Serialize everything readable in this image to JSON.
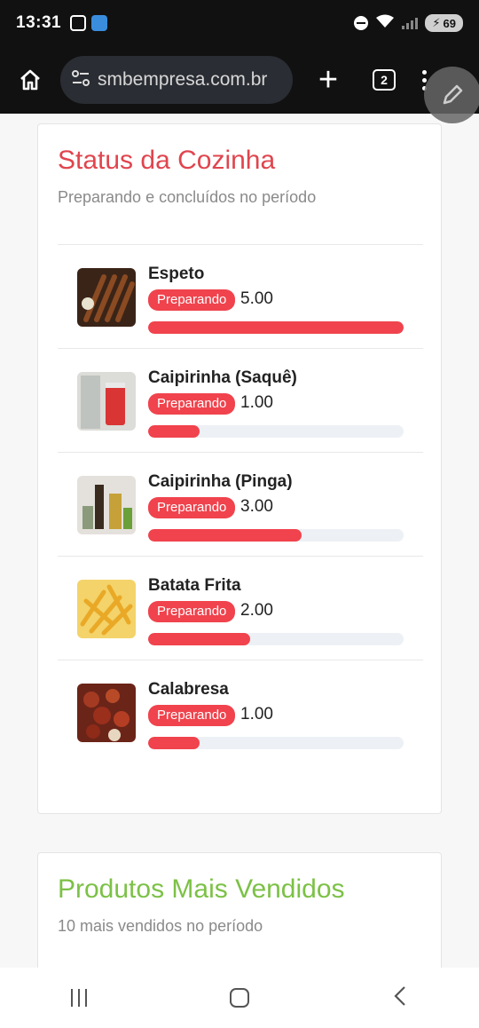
{
  "status_bar": {
    "time": "13:31",
    "battery": "69"
  },
  "browser": {
    "url": "smbempresa.com.br",
    "tab_count": "2",
    "plus_label": "+"
  },
  "kitchen": {
    "title": "Status da Cozinha",
    "subtitle": "Preparando e concluídos no período",
    "items": [
      {
        "name": "Espeto",
        "status": "Preparando",
        "qty": "5.00",
        "progress": 1.0,
        "thumb": "skewer-image"
      },
      {
        "name": "Caipirinha (Saquê)",
        "status": "Preparando",
        "qty": "1.00",
        "progress": 0.2,
        "thumb": "drink-sake-image"
      },
      {
        "name": "Caipirinha (Pinga)",
        "status": "Preparando",
        "qty": "3.00",
        "progress": 0.6,
        "thumb": "drink-pinga-image"
      },
      {
        "name": "Batata Frita",
        "status": "Preparando",
        "qty": "2.00",
        "progress": 0.4,
        "thumb": "fries-image"
      },
      {
        "name": "Calabresa",
        "status": "Preparando",
        "qty": "1.00",
        "progress": 0.2,
        "thumb": "calabresa-image"
      }
    ]
  },
  "top_products": {
    "title": "Produtos Mais Vendidos",
    "subtitle": "10 mais vendidos no período"
  },
  "colors": {
    "accent_red": "#f0434d",
    "title_red": "#e0454e",
    "title_green": "#7cc146"
  }
}
